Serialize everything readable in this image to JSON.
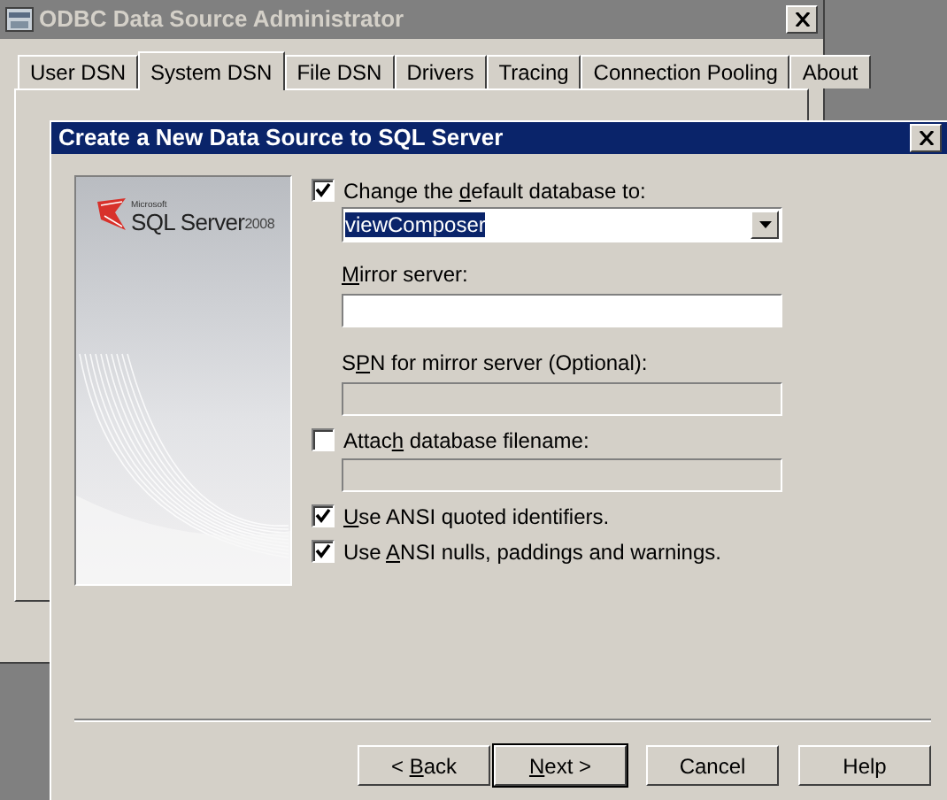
{
  "back_window": {
    "title": "ODBC Data Source Administrator",
    "tabs": [
      {
        "label": "User DSN",
        "selected": false
      },
      {
        "label": "System DSN",
        "selected": true
      },
      {
        "label": "File DSN",
        "selected": false
      },
      {
        "label": "Drivers",
        "selected": false
      },
      {
        "label": "Tracing",
        "selected": false
      },
      {
        "label": "Connection Pooling",
        "selected": false
      },
      {
        "label": "About",
        "selected": false
      }
    ]
  },
  "dialog": {
    "title": "Create a New Data Source to SQL Server",
    "logo": {
      "company": "Microsoft",
      "product": "SQL Server",
      "version": "2008"
    },
    "options": [
      {
        "kind": "checkbox",
        "label": {
          "pre": "Change the ",
          "key": "d",
          "post": "efault database to:"
        },
        "checked": true
      },
      {
        "kind": "combo",
        "value": "viewComposer",
        "selected": true
      },
      {
        "kind": "label",
        "label": {
          "key": "M",
          "post": "irror server:"
        }
      },
      {
        "kind": "input",
        "disabled": false
      },
      {
        "kind": "label",
        "label": {
          "pre": "S",
          "key": "P",
          "post": "N for mirror server (Optional):"
        }
      },
      {
        "kind": "input",
        "disabled": true
      },
      {
        "kind": "checkbox",
        "label": {
          "pre": "Attac",
          "key": "h",
          "post": " database filename:"
        },
        "checked": false
      },
      {
        "kind": "input",
        "disabled": true
      },
      {
        "kind": "checkbox",
        "label": {
          "key": "U",
          "post": "se ANSI quoted identifiers."
        },
        "checked": true
      },
      {
        "kind": "checkbox",
        "label": {
          "pre": "Use ",
          "key": "A",
          "post": "NSI nulls, paddings and warnings."
        },
        "checked": true
      }
    ],
    "buttons": [
      {
        "label": {
          "pre": "< ",
          "key": "B",
          "post": "ack"
        },
        "default": false
      },
      {
        "label": {
          "key": "N",
          "post": "ext >"
        },
        "default": true
      },
      {
        "label": {
          "pre": "Cancel"
        },
        "default": false
      },
      {
        "label": {
          "pre": "Help"
        },
        "default": false
      }
    ]
  }
}
